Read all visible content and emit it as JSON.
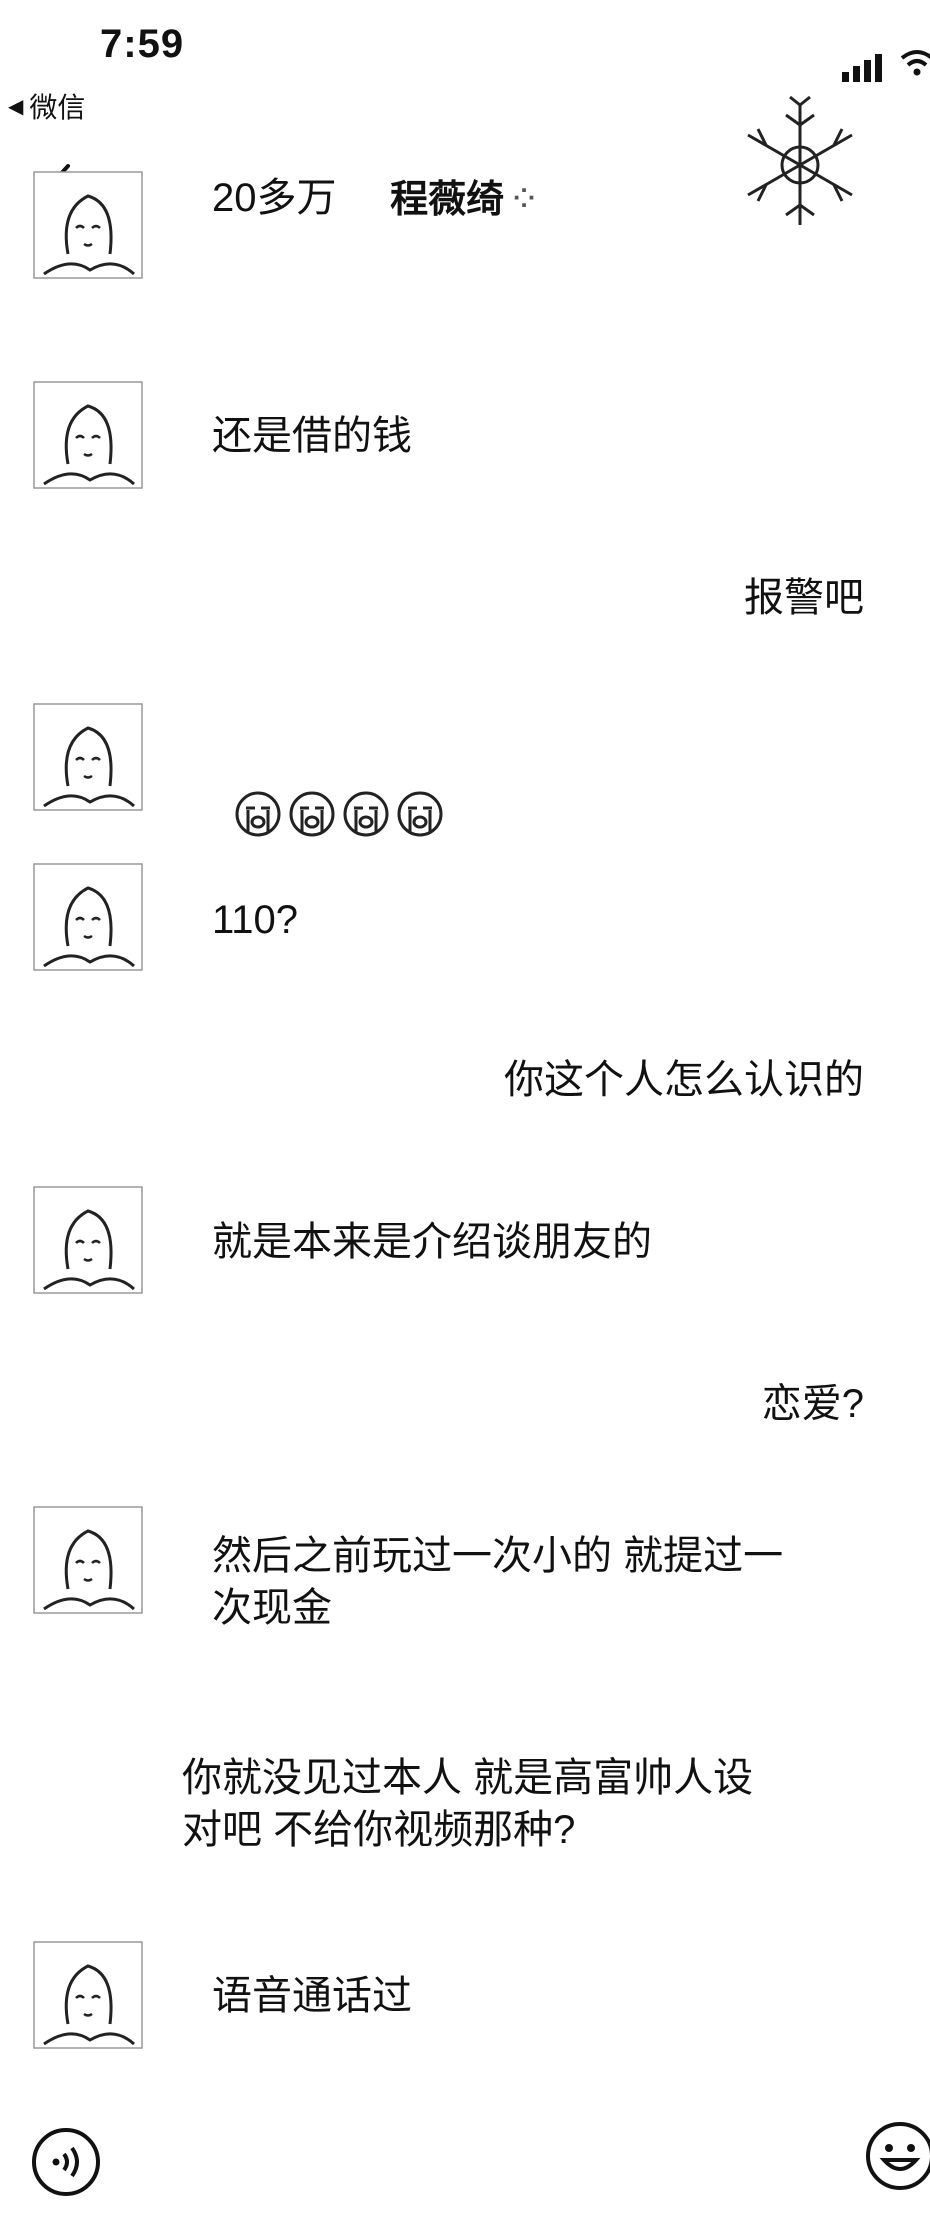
{
  "status_bar": {
    "time": "7:59",
    "back_app": "微信"
  },
  "nav": {
    "title": "程薇绮"
  },
  "messages": [
    {
      "side": "left",
      "text": "20多万"
    },
    {
      "side": "left",
      "text": "还是借的钱"
    },
    {
      "side": "right",
      "text": "报警吧"
    },
    {
      "side": "left",
      "text": "",
      "emoji_count": 4,
      "emoji_name": "crying-face-icon"
    },
    {
      "side": "left",
      "text": "110?"
    },
    {
      "side": "right",
      "text": "你这个人怎么认识的"
    },
    {
      "side": "left",
      "text": "就是本来是介绍谈朋友的"
    },
    {
      "side": "right",
      "text": "恋爱?"
    },
    {
      "side": "left",
      "text": "然后之前玩过一次小的 就提过一\n次现金"
    },
    {
      "side": "right",
      "text": "你就没见过本人 就是高富帅人设\n对吧 不给你视频那种?"
    },
    {
      "side": "left",
      "text": "语音通话过"
    }
  ],
  "bottom_bar": {
    "voice_icon": "voice-input-icon",
    "emoji_icon": "emoji-icon"
  }
}
